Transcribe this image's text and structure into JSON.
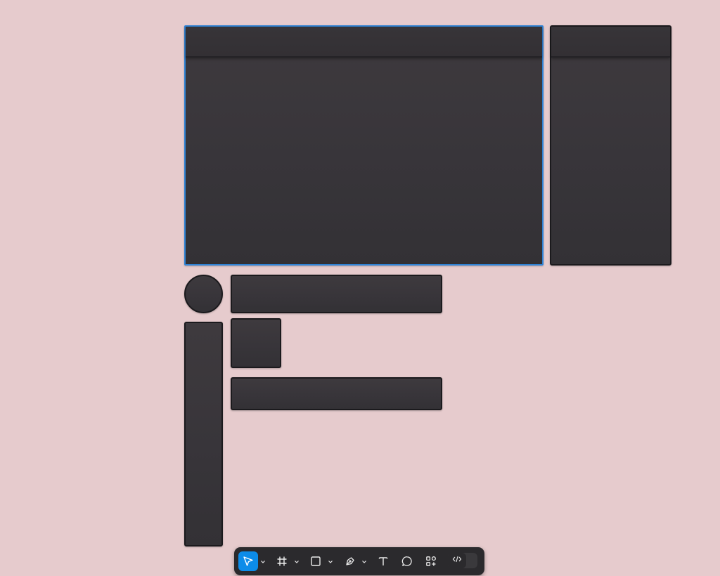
{
  "canvas": {
    "background_color": "#e6cbcd",
    "shape_fill": "#38353a",
    "selection_color": "#2f83d6"
  },
  "toolbar": {
    "tools": [
      {
        "name": "move",
        "icon": "cursor-arrow-icon",
        "active": true,
        "has_menu": true
      },
      {
        "name": "frame",
        "icon": "frame-hash-icon",
        "active": false,
        "has_menu": true
      },
      {
        "name": "shape",
        "icon": "rectangle-icon",
        "active": false,
        "has_menu": true
      },
      {
        "name": "pen",
        "icon": "pen-nib-icon",
        "active": false,
        "has_menu": true
      },
      {
        "name": "text",
        "icon": "text-t-icon",
        "active": false,
        "has_menu": false
      },
      {
        "name": "comment",
        "icon": "comment-bubble-icon",
        "active": false,
        "has_menu": false
      },
      {
        "name": "actions",
        "icon": "actions-grid-icon",
        "active": false,
        "has_menu": false
      }
    ],
    "dev_mode": {
      "icon": "code-brackets-icon",
      "enabled": false
    },
    "active_color": "#0c8ce9"
  }
}
